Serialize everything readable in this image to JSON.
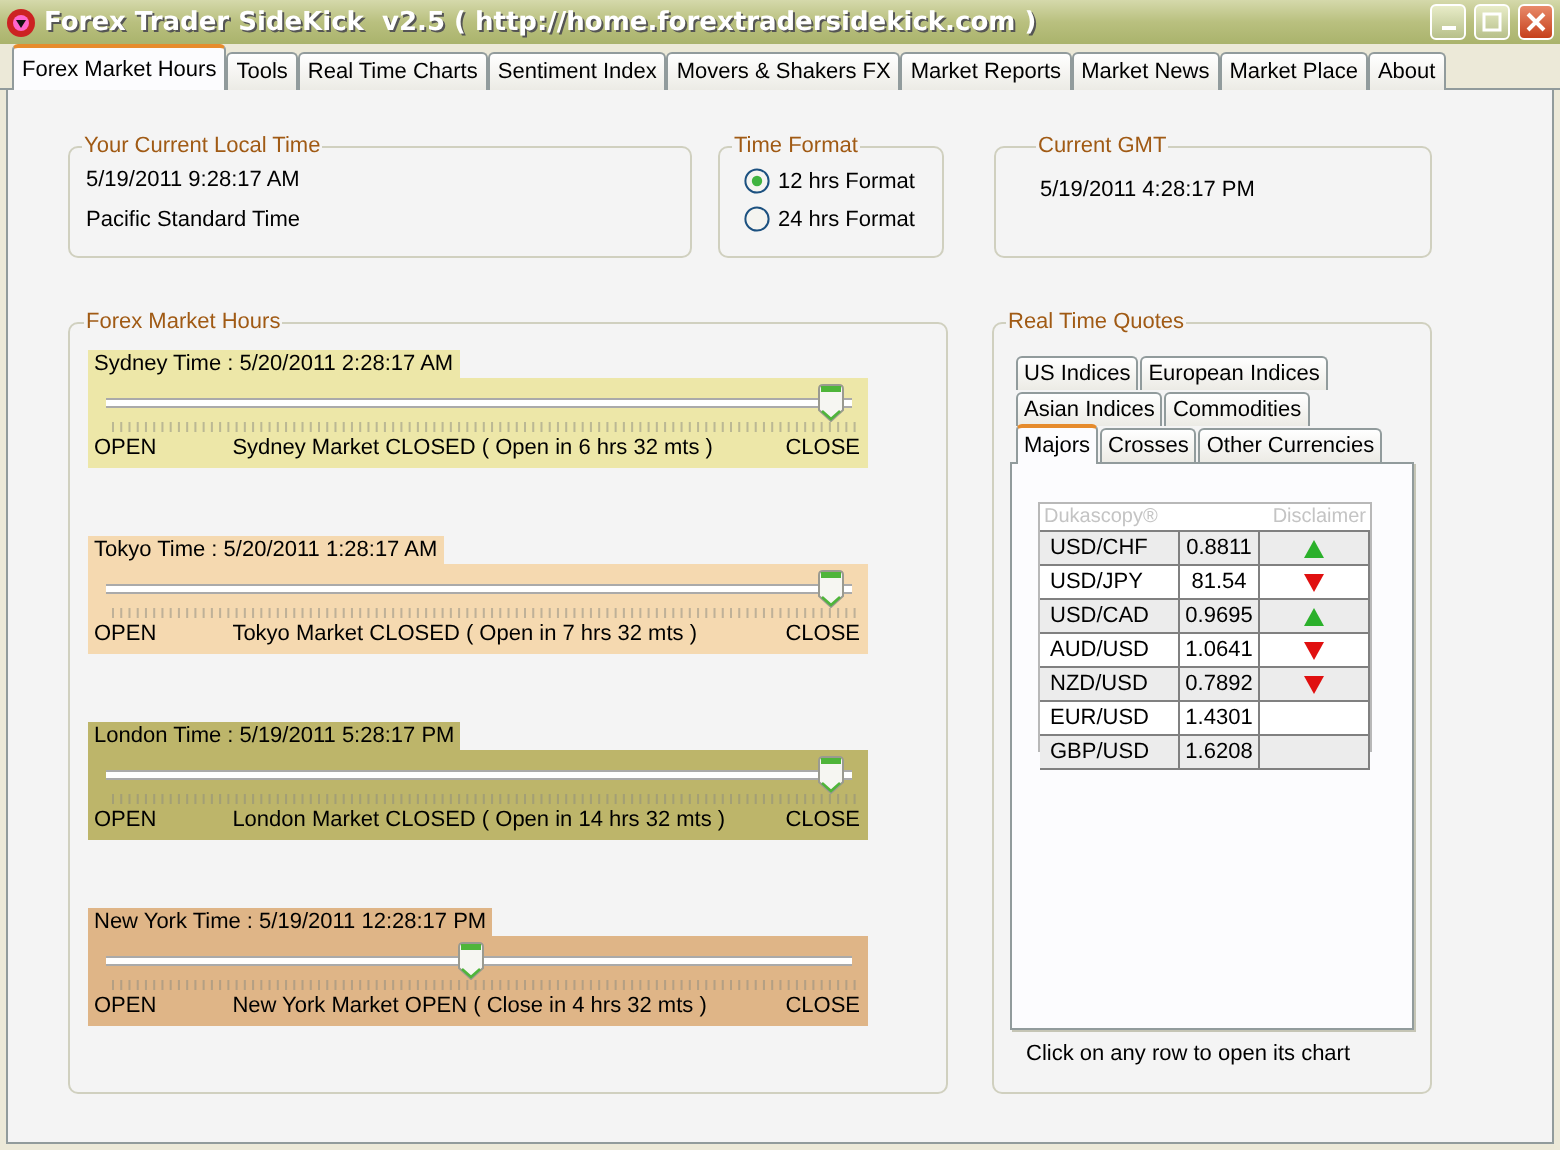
{
  "window": {
    "title": "Forex Trader SideKick  v2.5 ( http://home.forextradersidekick.com )"
  },
  "tabs": [
    {
      "label": "Forex Market Hours",
      "selected": true
    },
    {
      "label": "Tools",
      "selected": false
    },
    {
      "label": "Real Time Charts",
      "selected": false
    },
    {
      "label": "Sentiment Index",
      "selected": false
    },
    {
      "label": "Movers & Shakers FX",
      "selected": false
    },
    {
      "label": "Market Reports",
      "selected": false
    },
    {
      "label": "Market News",
      "selected": false
    },
    {
      "label": "Market Place",
      "selected": false
    },
    {
      "label": "About",
      "selected": false
    }
  ],
  "local_time": {
    "title": "Your Current Local Time",
    "time": "5/19/2011 9:28:17 AM",
    "zone": "Pacific Standard Time"
  },
  "time_format": {
    "title": "Time Format",
    "options": [
      {
        "label": "12 hrs Format",
        "selected": true
      },
      {
        "label": "24 hrs Format",
        "selected": false
      }
    ]
  },
  "gmt": {
    "title": "Current GMT",
    "time": "5/19/2011 4:28:17 PM"
  },
  "market_hours": {
    "title": "Forex Market Hours",
    "markets": [
      {
        "time_label": "Sydney Time : 5/20/2011 2:28:17 AM",
        "color": "#ede7a8",
        "level": 0.99,
        "open_label": "OPEN",
        "status": "Sydney Market CLOSED ( Open in 6 hrs 32 mts )",
        "close_label": "CLOSE"
      },
      {
        "time_label": "Tokyo Time : 5/20/2011 1:28:17 AM",
        "color": "#f5d9b0",
        "level": 0.99,
        "open_label": "OPEN",
        "status": "Tokyo Market CLOSED ( Open in 7 hrs 32 mts )",
        "close_label": "CLOSE"
      },
      {
        "time_label": "London Time : 5/19/2011 5:28:17 PM",
        "color": "#bdb56a",
        "level": 0.99,
        "open_label": "OPEN",
        "status": "London Market CLOSED ( Open in 14 hrs 32 mts )",
        "close_label": "CLOSE"
      },
      {
        "time_label": "New York Time : 5/19/2011 12:28:17 PM",
        "color": "#dfb587",
        "level": 0.49,
        "open_label": "OPEN",
        "status": "New York Market OPEN ( Close in 4 hrs 32 mts )",
        "close_label": "CLOSE"
      }
    ]
  },
  "quotes": {
    "title": "Real Time Quotes",
    "tab_rows": [
      [
        {
          "label": "US Indices",
          "selected": false
        },
        {
          "label": "European Indices",
          "selected": false
        }
      ],
      [
        {
          "label": "Asian Indices",
          "selected": false
        },
        {
          "label": "Commodities",
          "selected": false
        }
      ],
      [
        {
          "label": "Majors",
          "selected": true
        },
        {
          "label": "Crosses",
          "selected": false
        },
        {
          "label": "Other Currencies",
          "selected": false
        }
      ]
    ],
    "table": {
      "source": "Dukascopy®",
      "disclaimer": "Disclaimer",
      "rows": [
        {
          "pair": "USD/CHF",
          "price": "0.8811",
          "rising": true
        },
        {
          "pair": "USD/JPY",
          "price": "81.54",
          "rising": false
        },
        {
          "pair": "USD/CAD",
          "price": "0.9695",
          "rising": true
        },
        {
          "pair": "AUD/USD",
          "price": "1.0641",
          "rising": false
        },
        {
          "pair": "NZD/USD",
          "price": "0.7892",
          "rising": false
        },
        {
          "pair": "EUR/USD",
          "price": "1.4301"
        },
        {
          "pair": "GBP/USD",
          "price": "1.6208"
        }
      ]
    },
    "hint": "Click on any row to open its chart"
  }
}
